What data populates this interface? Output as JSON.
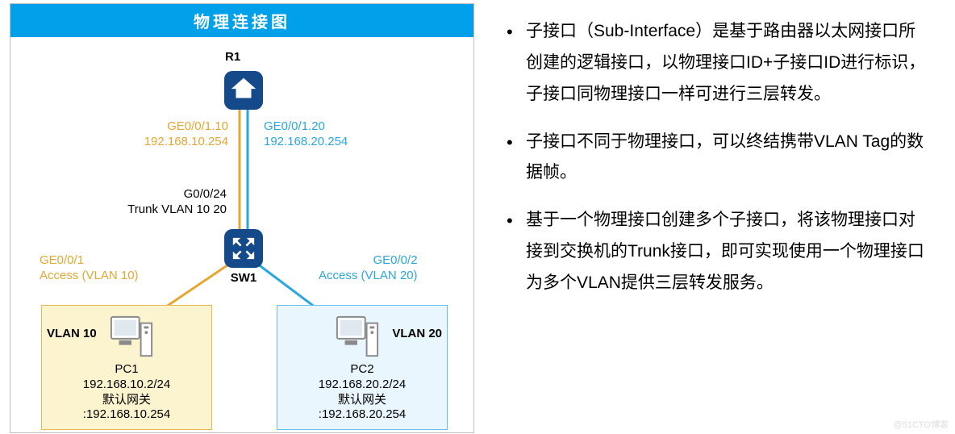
{
  "panel_title": "物理连接图",
  "router": {
    "name": "R1"
  },
  "switch": {
    "name": "SW1"
  },
  "sub_if_left": {
    "if": "GE0/0/1.10",
    "ip": "192.168.10.254"
  },
  "sub_if_right": {
    "if": "GE0/0/1.20",
    "ip": "192.168.20.254"
  },
  "trunk": {
    "port": "G0/0/24",
    "mode": "Trunk VLAN 10 20"
  },
  "access1": {
    "port": "GE0/0/1",
    "mode": "Access (VLAN 10)"
  },
  "access2": {
    "port": "GE0/0/2",
    "mode": "Access (VLAN 20)"
  },
  "vlan10": {
    "tag": "VLAN 10",
    "pc": "PC1",
    "ip": "192.168.10.2/24",
    "gw_label": "默认网关",
    "gw": ":192.168.10.254"
  },
  "vlan20": {
    "tag": "VLAN 20",
    "pc": "PC2",
    "ip": "192.168.20.2/24",
    "gw_label": "默认网关",
    "gw": ":192.168.20.254"
  },
  "bullets": [
    "子接口（Sub-Interface）是基于路由器以太网接口所创建的逻辑接口，以物理接口ID+子接口ID进行标识，子接口同物理接口一样可进行三层转发。",
    "子接口不同于物理接口，可以终结携带VLAN Tag的数据帧。",
    "基于一个物理接口创建多个子接口，将该物理接口对接到交换机的Trunk接口，即可实现使用一个物理接口为多个VLAN提供三层转发服务。"
  ],
  "watermark": "@51CTO博客",
  "chart_data": {
    "type": "network-topology",
    "nodes": [
      {
        "id": "R1",
        "kind": "router",
        "sub_interfaces": [
          {
            "name": "GE0/0/1.10",
            "ip": "192.168.10.254",
            "vlan": 10
          },
          {
            "name": "GE0/0/1.20",
            "ip": "192.168.20.254",
            "vlan": 20
          }
        ]
      },
      {
        "id": "SW1",
        "kind": "switch"
      },
      {
        "id": "PC1",
        "kind": "host",
        "vlan": 10,
        "ip": "192.168.10.2/24",
        "gateway": "192.168.10.254"
      },
      {
        "id": "PC2",
        "kind": "host",
        "vlan": 20,
        "ip": "192.168.20.2/24",
        "gateway": "192.168.20.254"
      }
    ],
    "links": [
      {
        "from": "R1",
        "to": "SW1",
        "port_sw": "G0/0/24",
        "mode": "Trunk",
        "vlans": [
          10,
          20
        ]
      },
      {
        "from": "SW1",
        "to": "PC1",
        "port_sw": "GE0/0/1",
        "mode": "Access",
        "vlan": 10
      },
      {
        "from": "SW1",
        "to": "PC2",
        "port_sw": "GE0/0/2",
        "mode": "Access",
        "vlan": 20
      }
    ]
  }
}
